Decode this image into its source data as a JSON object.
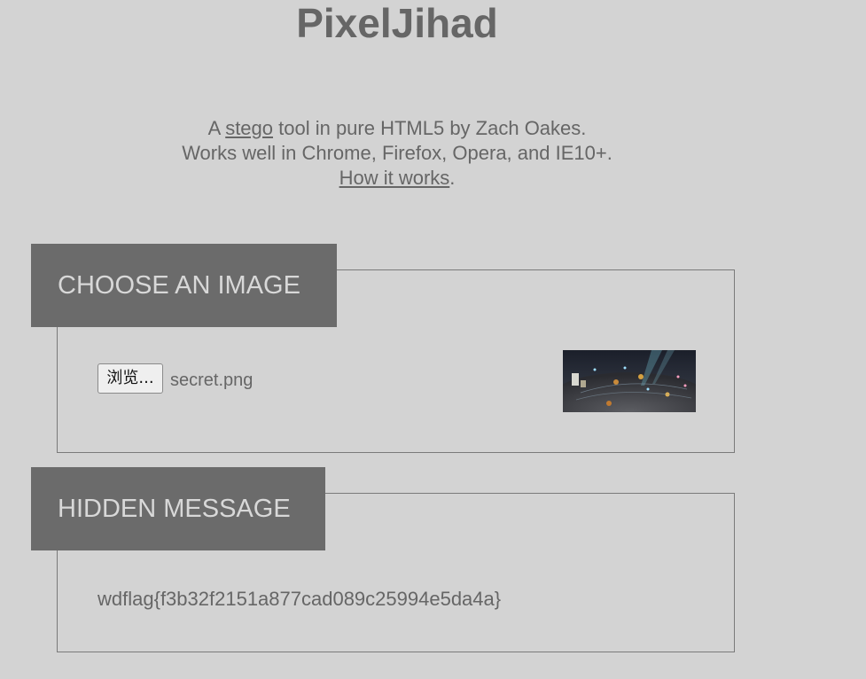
{
  "app": {
    "title": "PixelJihad"
  },
  "tagline": {
    "line1_prefix": "A ",
    "line1_link": "stego",
    "line1_suffix": " tool in pure HTML5 by Zach Oakes.",
    "line2": "Works well in Chrome, Firefox, Opera, and IE10+.",
    "line3_link": "How it works",
    "line3_suffix": "."
  },
  "choose_image": {
    "header": "CHOOSE AN IMAGE",
    "browse_label": "浏览...",
    "file_name": "secret.png"
  },
  "hidden_message": {
    "header": "HIDDEN MESSAGE",
    "text": "wdflag{f3b32f2151a877cad089c25994e5da4a}"
  },
  "colors": {
    "background": "#d3d3d3",
    "text": "#666666",
    "header_background": "#6b6b6b",
    "header_text": "#d8d8d8",
    "border": "#7a7a7a"
  }
}
